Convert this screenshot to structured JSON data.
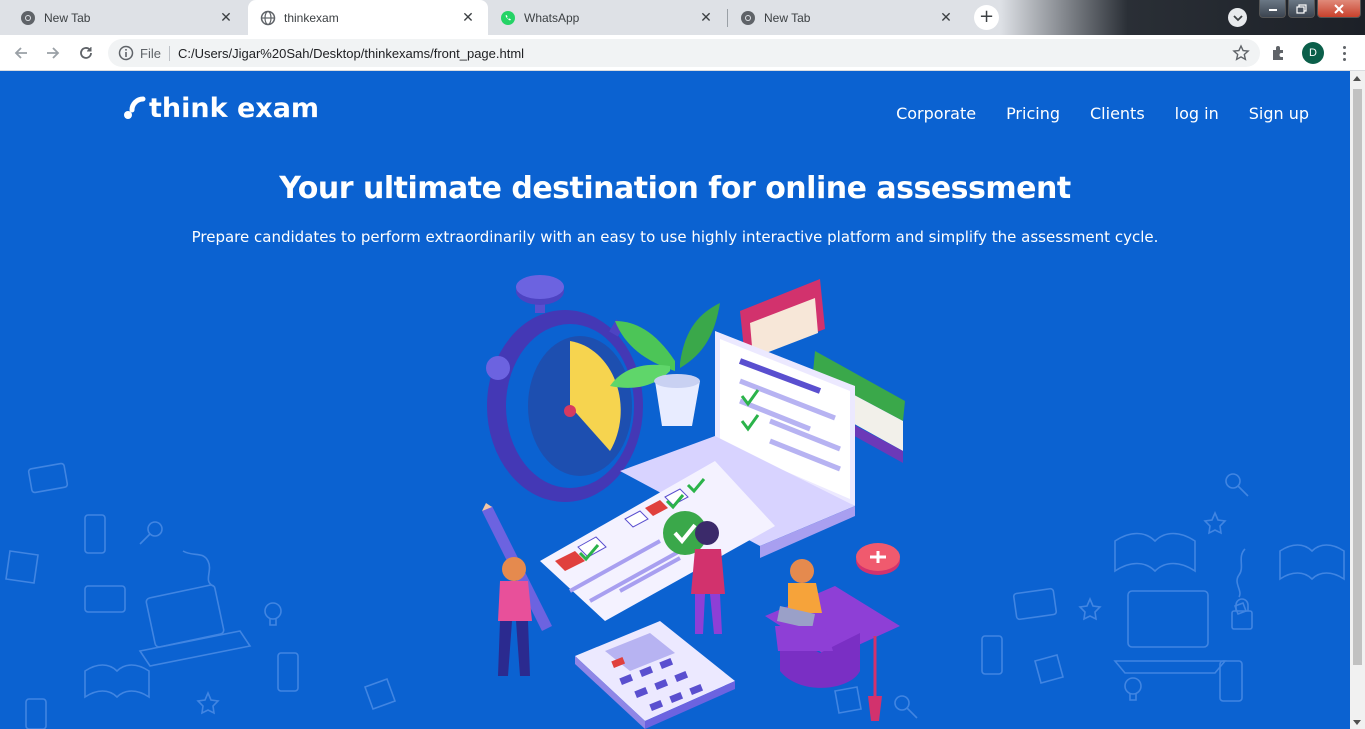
{
  "tabs": [
    {
      "title": "New Tab",
      "favicon": "chrome-icon",
      "active": false
    },
    {
      "title": "thinkexam",
      "favicon": "globe-icon",
      "active": true
    },
    {
      "title": "WhatsApp",
      "favicon": "whatsapp-icon",
      "active": false
    },
    {
      "title": "New Tab",
      "favicon": "chrome-icon",
      "active": false
    }
  ],
  "addressbar": {
    "scheme_label": "File",
    "url": "C:/Users/Jigar%20Sah/Desktop/thinkexams/front_page.html"
  },
  "profile": {
    "initial": "D",
    "color": "#0b5f4a"
  },
  "site": {
    "brand": "think exam",
    "nav": [
      "Corporate",
      "Pricing",
      "Clients",
      "log in",
      "Sign up"
    ],
    "headline": "Your ultimate destination for online assessment",
    "subheadline": "Prepare candidates to perform extraordinarily with an easy to use highly interactive platform and simplify the assessment cycle.",
    "background_color": "#0b62d1"
  }
}
